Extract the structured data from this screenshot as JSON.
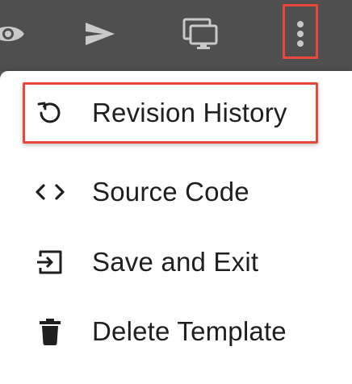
{
  "toolbar": {
    "icons": [
      "eye-icon",
      "send-icon",
      "monitor-icon",
      "more-vert-icon"
    ],
    "icon_color": "#c9c9c9",
    "highlight_color": "#e8473a"
  },
  "menu": {
    "items": [
      {
        "label": "Revision History",
        "icon": "history-icon"
      },
      {
        "label": "Source Code",
        "icon": "code-icon"
      },
      {
        "label": "Save and Exit",
        "icon": "exit-icon"
      },
      {
        "label": "Delete Template",
        "icon": "trash-icon"
      }
    ]
  }
}
